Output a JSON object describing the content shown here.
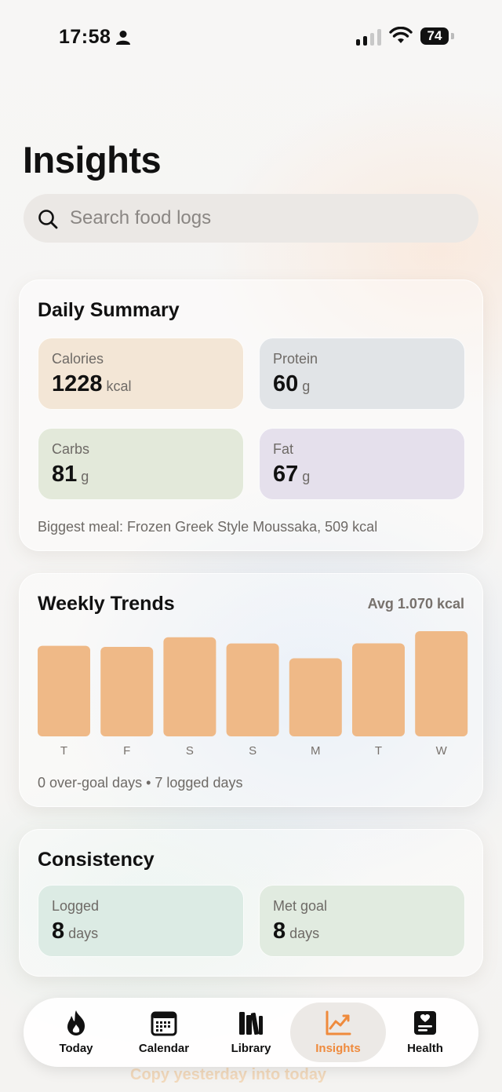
{
  "status_bar": {
    "time": "17:58",
    "battery": "74"
  },
  "page": {
    "title": "Insights"
  },
  "search": {
    "placeholder": "Search food logs"
  },
  "daily_summary": {
    "title": "Daily Summary",
    "tiles": [
      {
        "label": "Calories",
        "value": "1228",
        "unit": "kcal",
        "color": "#f3e6d6"
      },
      {
        "label": "Protein",
        "value": "60",
        "unit": "g",
        "color": "#e1e4e7"
      },
      {
        "label": "Carbs",
        "value": "81",
        "unit": "g",
        "color": "#e3e9da"
      },
      {
        "label": "Fat",
        "value": "67",
        "unit": "g",
        "color": "#e5e0ec"
      }
    ],
    "footnote": "Biggest meal: Frozen Greek Style Moussaka, 509 kcal"
  },
  "weekly_trends": {
    "title": "Weekly Trends",
    "avg_label": "Avg 1.070 kcal",
    "footnote": "0 over-goal days • 7 logged days",
    "bar_color": "#efb987"
  },
  "chart_data": {
    "type": "bar",
    "categories": [
      "T",
      "F",
      "S",
      "S",
      "M",
      "T",
      "W"
    ],
    "values": [
      1057,
      1045,
      1157,
      1085,
      912,
      1086,
      1228
    ],
    "title": "Weekly Trends",
    "ylim": [
      0,
      1228
    ]
  },
  "consistency": {
    "title": "Consistency",
    "tiles": [
      {
        "label": "Logged",
        "value": "8",
        "unit": "days",
        "color": "#dcebe4"
      },
      {
        "label": "Met goal",
        "value": "8",
        "unit": "days",
        "color": "#e1ebe0"
      }
    ]
  },
  "tab_bar": {
    "items": [
      {
        "label": "Today",
        "icon": "flame-icon"
      },
      {
        "label": "Calendar",
        "icon": "calendar-icon"
      },
      {
        "label": "Library",
        "icon": "books-icon"
      },
      {
        "label": "Insights",
        "icon": "chart-line-icon",
        "active": true
      },
      {
        "label": "Health",
        "icon": "health-icon"
      }
    ],
    "accent_color": "#ef8a3c"
  },
  "background_hint": {
    "text": "Copy yesterday into today"
  }
}
